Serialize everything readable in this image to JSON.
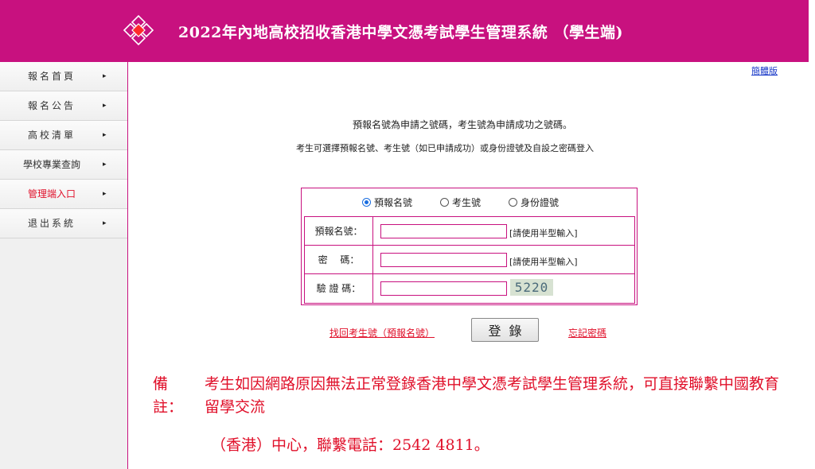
{
  "header": {
    "title": "2022年內地高校招收香港中學文憑考試學生管理系統 （學生端)",
    "logo_icon": "diamond-logo-icon",
    "bg_color": "#c8117f"
  },
  "sidebar": {
    "arrow": "▸",
    "items": [
      {
        "label": "報名首頁"
      },
      {
        "label": "報名公告"
      },
      {
        "label": "高校清單"
      },
      {
        "label": "學校專業查詢"
      },
      {
        "label": "管理端入口"
      },
      {
        "label": "退出系統"
      }
    ]
  },
  "content": {
    "lang_link": "簡體版",
    "info_line1": "預報名號為申請之號碼，考生號為申請成功之號碼。",
    "info_line2": "考生可選擇預報名號、考生號（如已申請成功）或身份證號及自設之密碼登入"
  },
  "login": {
    "radios": [
      {
        "label": "預報名號",
        "selected": true
      },
      {
        "label": "考生號",
        "selected": false
      },
      {
        "label": "身份證號",
        "selected": false
      }
    ],
    "fields": {
      "id_label": "預報名號：",
      "id_hint": "[請使用半型輸入]",
      "password_label": "密　 碼：",
      "password_hint": "[請使用半型輸入]",
      "captcha_label": "驗 證 碼：",
      "captcha_value": "5220"
    },
    "find_link": "找回考生號（預報名號）",
    "login_button": "登錄",
    "forgot_link": "忘記密碼"
  },
  "note": {
    "head": "備註：",
    "body": "考生如因網路原因無法正常登錄香港中學文憑考試學生管理系統，可直接聯繫中國教育留學交流",
    "line3": "（香港）中心，聯繫電話：2542 4811。"
  },
  "colors": {
    "accent": "#c8117f",
    "note_red": "#e0102a",
    "link_blue": "#1a3ac8"
  }
}
